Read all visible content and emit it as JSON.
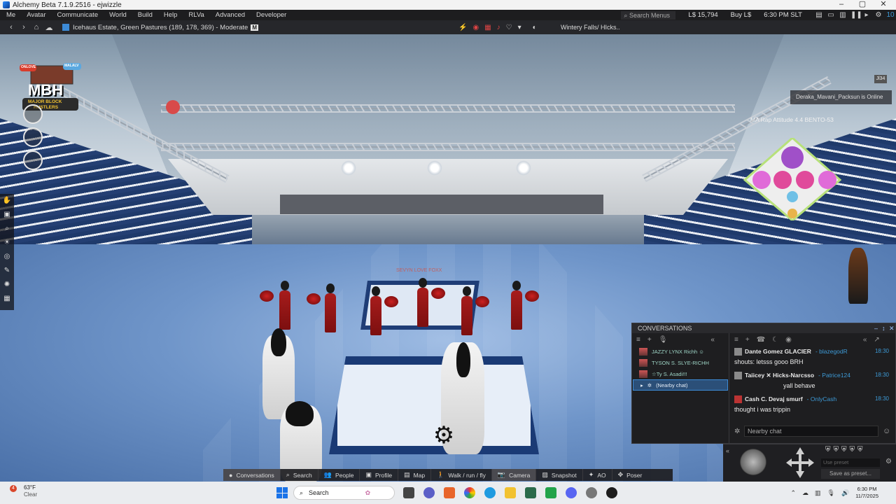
{
  "window": {
    "title": "Alchemy Beta 7.1.9.2516 - ejwizzle",
    "controls": [
      "minimize",
      "maximize",
      "close"
    ]
  },
  "menubar": {
    "items": [
      "Me",
      "Avatar",
      "Communicate",
      "World",
      "Build",
      "Help",
      "RLVa",
      "Advanced",
      "Developer"
    ],
    "search_placeholder": "Search Menus",
    "balance": "L$ 15,794",
    "buy": "Buy L$",
    "time": "6:30 PM SLT",
    "count": "10"
  },
  "navbar": {
    "location": "Icehaus Estate, Green Pastures (189, 178, 369) - Moderate",
    "maturity": "M",
    "parcel": "Wintery Falls/ HIcks.."
  },
  "scene": {
    "floor_text": "SEVYN LOVE FOXX",
    "hud_logo_line1": "MBH",
    "hud_logo_line2": "MAJOR BLOCK",
    "hud_logo_line3": "HUSTLERS",
    "hud_logo_badge_left": "ONLOVE",
    "hud_logo_badge_right": "MALALV",
    "toast": "Deraka_Mavani_Packsun is Online",
    "floating_tag": "MA Rap Attitude 4.4 BENTO-53",
    "mini_badge": "Jl34"
  },
  "conversations": {
    "title": "CONVERSATIONS",
    "sessions": [
      {
        "label": "JAZZY LYNX Richh ☺",
        "selected": false
      },
      {
        "label": "TYSON S. SLYE-RICHH",
        "selected": false
      },
      {
        "label": "☆Ty S. Asadi!!!",
        "selected": false
      },
      {
        "label": "(Nearby chat)",
        "selected": true
      }
    ],
    "messages": [
      {
        "name": "Dante Gomez  GLACIER",
        "user": "- blazegodR",
        "time": "18:30",
        "text": "shouts: letsss gooo BRH"
      },
      {
        "name": "Taiicey ✕ Hicks-Narcsso",
        "user": "- Patrice124",
        "time": "18:30",
        "text": "yall behave"
      },
      {
        "name": "Cash C. Devaj smurf",
        "user": "- OnlyCash",
        "time": "18:30",
        "text": "thought i was trippin"
      }
    ],
    "input_placeholder": "Nearby chat"
  },
  "camera": {
    "preset_placeholder": "Use preset",
    "save_preset": "Save as preset..."
  },
  "toolbar": {
    "buttons": [
      {
        "label": "Conversations",
        "icon": "chat-bubble-icon",
        "active": true
      },
      {
        "label": "Search",
        "icon": "search-icon",
        "active": false
      },
      {
        "label": "People",
        "icon": "people-icon",
        "active": false
      },
      {
        "label": "Profile",
        "icon": "profile-icon",
        "active": false
      },
      {
        "label": "Map",
        "icon": "map-icon",
        "active": false
      },
      {
        "label": "Walk / run / fly",
        "icon": "walk-icon",
        "active": false
      },
      {
        "label": "Camera",
        "icon": "camera-icon",
        "active": true
      },
      {
        "label": "Snapshot",
        "icon": "snapshot-icon",
        "active": false
      },
      {
        "label": "AO",
        "icon": "ao-icon",
        "active": false
      },
      {
        "label": "Poser",
        "icon": "poser-icon",
        "active": false
      }
    ]
  },
  "taskbar": {
    "weather_temp": "63°F",
    "weather_desc": "Clear",
    "weather_badge": "4",
    "search_label": "Search",
    "clock_time": "6:30 PM",
    "clock_date": "11/7/2025"
  }
}
